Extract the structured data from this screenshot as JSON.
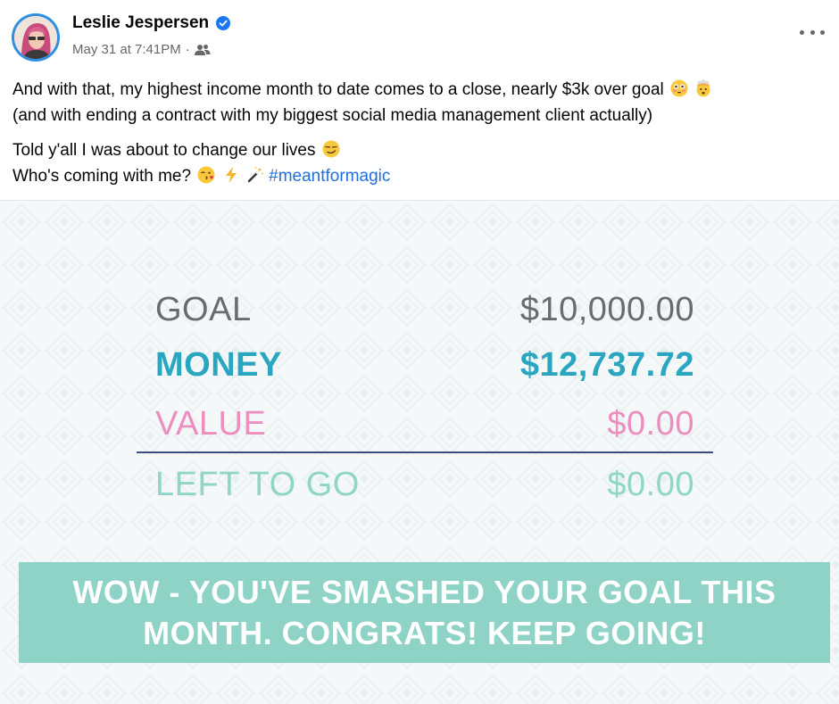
{
  "post": {
    "author": "Leslie Jespersen",
    "date": "May 31 at 7:41PM",
    "separator": "·",
    "audience_icon": "friends-icon",
    "verified_icon": "verified-badge-icon",
    "more_icon": "more-options-icon",
    "paragraph1_line1": "And with that, my highest income month to date comes to a close, nearly $3k over goal",
    "paragraph1_line2": "(and with ending a contract with my biggest social media management client actually)",
    "paragraph2_line1": "Told y'all I was about to change our lives",
    "paragraph2_line2": "Who's coming with me?",
    "hashtag": "#meantformagic"
  },
  "image": {
    "rows": [
      {
        "label": "GOAL",
        "value": "$10,000.00",
        "color": "#6b6b6e"
      },
      {
        "label": "MONEY",
        "value": "$12,737.72",
        "color": "#2ba6c0"
      },
      {
        "label": "VALUE",
        "value": "$0.00",
        "color": "#ec8fbf"
      },
      {
        "label": "LEFT TO GO",
        "value": "$0.00",
        "color": "#8fd6c6"
      }
    ],
    "banner_line1": "WOW - YOU'VE SMASHED YOUR GOAL THIS",
    "banner_line2": "MONTH. CONGRATS! KEEP GOING!",
    "banner_color": "#8fd2c6",
    "divider_color": "#3d4b83"
  }
}
